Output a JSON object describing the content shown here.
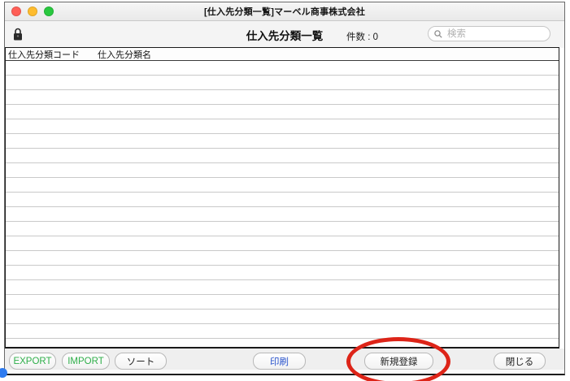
{
  "window": {
    "title": "[仕入先分類一覧]マーベル商事株式会社"
  },
  "toolbar": {
    "view_title": "仕入先分類一覧",
    "record_count_label": "件数 :",
    "record_count": "0",
    "search_placeholder": "検索",
    "lock_icon": "closed-padlock",
    "search_icon": "magnifier"
  },
  "table": {
    "columns": [
      {
        "label": "仕入先分類コード"
      },
      {
        "label": "仕入先分類名"
      }
    ],
    "rows": []
  },
  "footer": {
    "buttons": [
      {
        "label": "EXPORT",
        "text_color": "#2faf4a"
      },
      {
        "label": "IMPORT",
        "text_color": "#2faf4a"
      },
      {
        "label": "ソート",
        "text_color": "#222222"
      },
      {
        "label": "印刷",
        "text_color": "#2953cc"
      },
      {
        "label": "新規登録",
        "text_color": "#222222"
      },
      {
        "label": "閉じる",
        "text_color": "#222222"
      }
    ]
  },
  "annotation": {
    "shape": "ellipse",
    "target": "新規登録",
    "color": "#dd2418"
  },
  "colors": {
    "traffic_close": "#ff5f57",
    "traffic_minimize": "#febc2e",
    "traffic_zoom": "#29c83f",
    "titlebar_bg": "#eeeeee",
    "footer_bg": "#efefef",
    "row_separator": "#c9c9c9"
  }
}
